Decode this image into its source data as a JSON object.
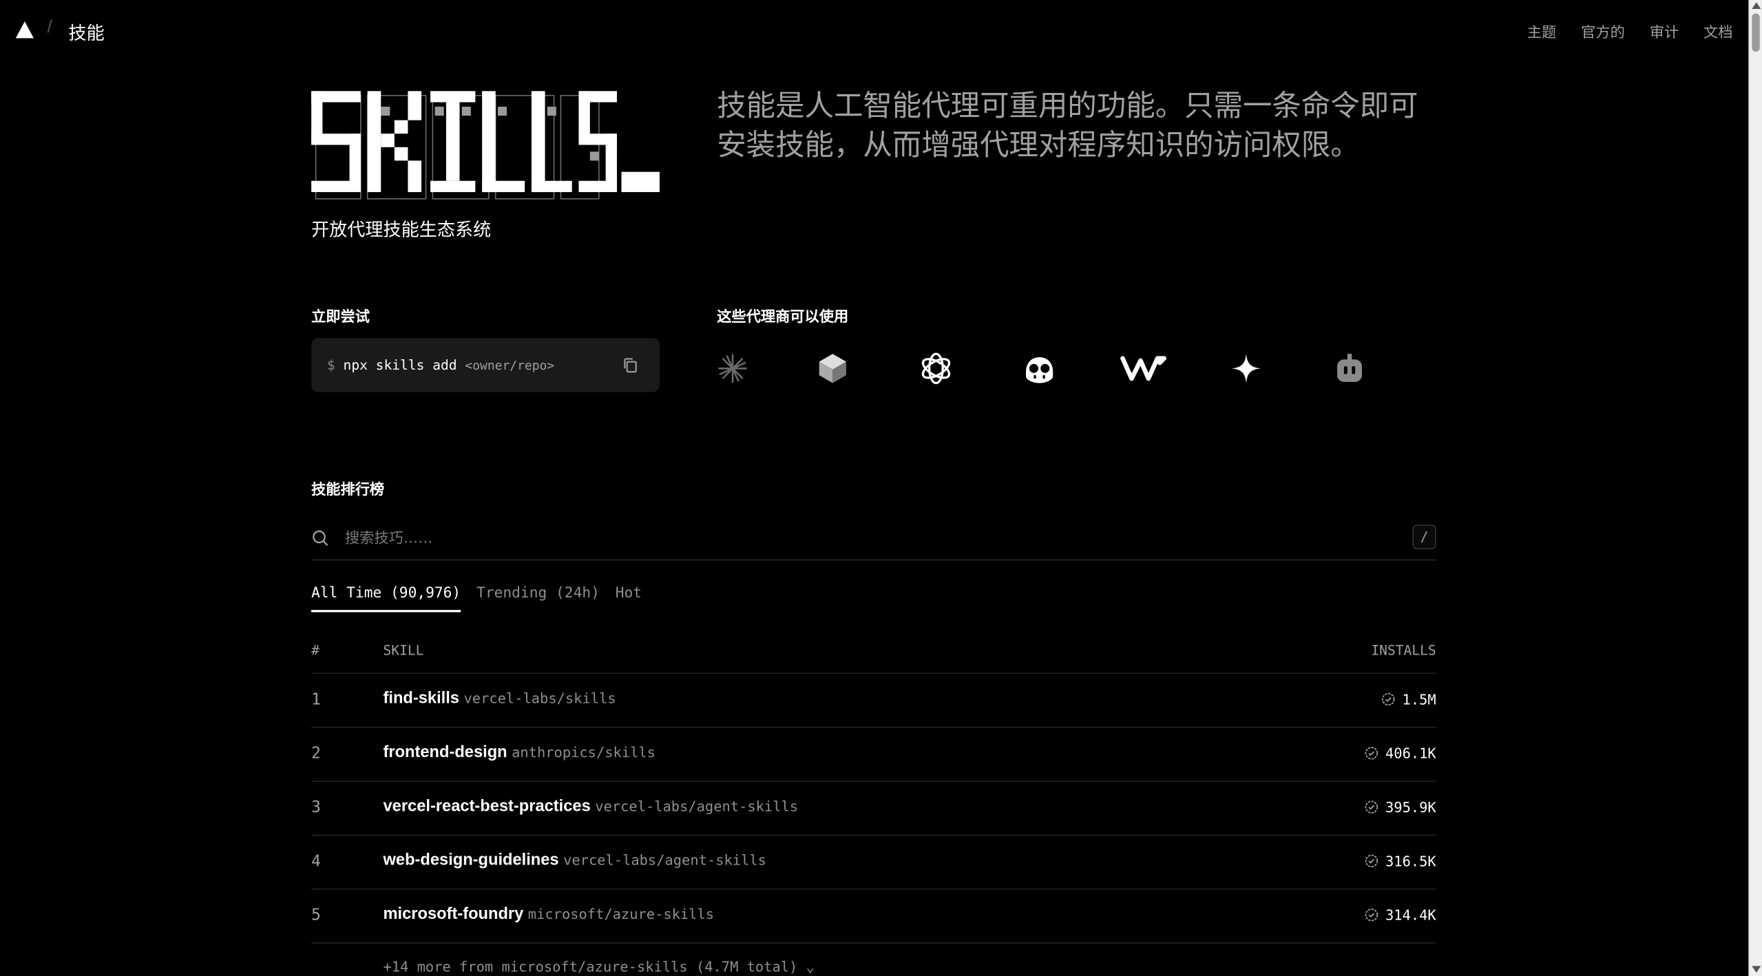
{
  "nav": {
    "brand_icon": "triangle-logo-icon",
    "separator": "/",
    "title": "技能",
    "links": [
      "主题",
      "官方的",
      "审计",
      "文档"
    ]
  },
  "hero": {
    "logo_text": "SKILLS_",
    "subtitle": "开放代理技能生态系统",
    "description": "技能是人工智能代理可重用的功能。只需一条命令即可安装技能，从而增强代理对程序知识的访问权限。"
  },
  "try_now": {
    "label": "立即尝试",
    "prompt": "$",
    "command": "npx skills add",
    "arg": "<owner/repo>",
    "copy_icon": "copy-icon"
  },
  "agents": {
    "label": "这些代理商可以使用",
    "icons": [
      "sparkle-burst-icon",
      "cube-icon",
      "openai-knot-icon",
      "copilot-face-icon",
      "windsurf-w-icon",
      "four-point-star-icon",
      "robot-head-icon"
    ]
  },
  "leaderboard": {
    "label": "技能排行榜",
    "search_placeholder": "搜索技巧……",
    "shortcut": "/",
    "tabs": [
      "All Time (90,976)",
      "Trending (24h)",
      "Hot"
    ],
    "active_tab": 0,
    "headers": {
      "rank": "#",
      "skill": "SKILL",
      "installs": "INSTALLS"
    },
    "rows": [
      {
        "rank": "1",
        "name": "find-skills",
        "repo": "vercel-labs/skills",
        "installs": "1.5M"
      },
      {
        "rank": "2",
        "name": "frontend-design",
        "repo": "anthropics/skills",
        "installs": "406.1K"
      },
      {
        "rank": "3",
        "name": "vercel-react-best-practices",
        "repo": "vercel-labs/agent-skills",
        "installs": "395.9K"
      },
      {
        "rank": "4",
        "name": "web-design-guidelines",
        "repo": "vercel-labs/agent-skills",
        "installs": "316.5K"
      },
      {
        "rank": "5",
        "name": "microsoft-foundry",
        "repo": "microsoft/azure-skills",
        "installs": "314.4K"
      }
    ],
    "more": "+14 more from microsoft/azure-skills (4.7M total) ⌄"
  }
}
